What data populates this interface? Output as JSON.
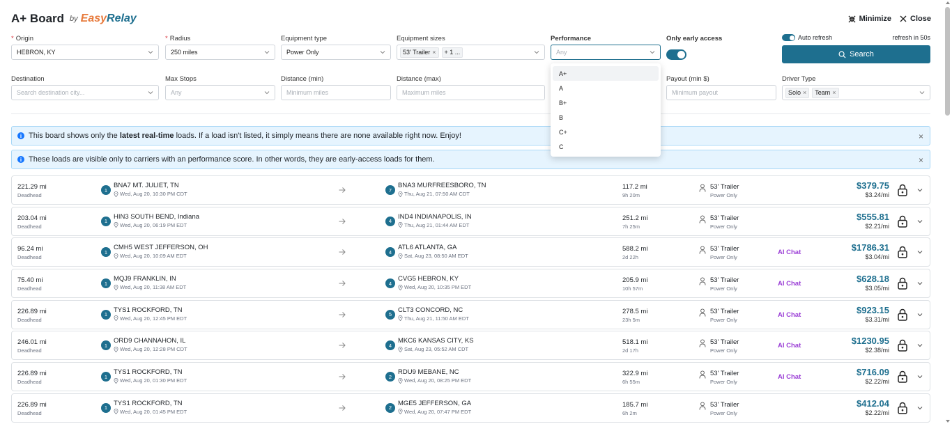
{
  "header": {
    "title": "A+ Board",
    "by": "by",
    "brand_a": "Easy",
    "brand_b": "Relay",
    "minimize": "Minimize",
    "close": "Close"
  },
  "filters": {
    "origin": {
      "label": "Origin",
      "value": "HEBRON, KY"
    },
    "radius": {
      "label": "Radius",
      "value": "250 miles"
    },
    "equipment_type": {
      "label": "Equipment type",
      "value": "Power Only"
    },
    "equipment_sizes": {
      "label": "Equipment sizes",
      "tag": "53' Trailer",
      "more": "+ 1 ..."
    },
    "performance": {
      "label": "Performance",
      "placeholder": "Any"
    },
    "early_access": {
      "label": "Only early access"
    },
    "auto_refresh": {
      "label": "Auto refresh",
      "countdown": "refresh in 50s"
    },
    "search": "Search",
    "destination": {
      "label": "Destination",
      "placeholder": "Search destination city..."
    },
    "max_stops": {
      "label": "Max Stops",
      "placeholder": "Any"
    },
    "distance_min": {
      "label": "Distance (min)",
      "placeholder": "Minimum miles"
    },
    "distance_max": {
      "label": "Distance (max)",
      "placeholder": "Maximum miles"
    },
    "payout_min": {
      "label": "Payout (min $)",
      "placeholder": "Minimum payout"
    },
    "driver_type": {
      "label": "Driver Type",
      "tags": [
        "Solo",
        "Team"
      ]
    }
  },
  "performance_options": [
    "A+",
    "A",
    "B+",
    "B",
    "C+",
    "C"
  ],
  "banners": {
    "b1_pre": "This board shows only the ",
    "b1_bold": "latest real-time",
    "b1_post": " loads. If a load isn't listed, it simply means there are none available right now. Enjoy!",
    "b2": "These loads are visible only to carriers with an performance score. In other words, they are early-access loads for them."
  },
  "row_labels": {
    "deadhead": "Deadhead",
    "ai_chat": "AI Chat"
  },
  "loads": [
    {
      "deadhead": "221.29 mi",
      "o_num": "1",
      "o_city": "BNA7 MT. JULIET, TN",
      "o_time": "Wed, Aug 20, 10:30 PM CDT",
      "d_num": "7",
      "d_city": "BNA3 MURFREESBORO, TN",
      "d_time": "Thu, Aug 21, 07:50 AM CDT",
      "dist": "117.2 mi",
      "dur": "9h 20m",
      "equip": "53' Trailer",
      "type": "Power Only",
      "ai": "",
      "price": "$379.75",
      "rate": "$3.24/mi"
    },
    {
      "deadhead": "203.04 mi",
      "o_num": "1",
      "o_city": "HIN3 SOUTH BEND, Indiana",
      "o_time": "Wed, Aug 20, 06:19 PM EDT",
      "d_num": "4",
      "d_city": "IND4 INDIANAPOLIS, IN",
      "d_time": "Thu, Aug 21, 01:44 AM EDT",
      "dist": "251.2 mi",
      "dur": "7h 25m",
      "equip": "53' Trailer",
      "type": "Power Only",
      "ai": "",
      "price": "$555.81",
      "rate": "$2.21/mi"
    },
    {
      "deadhead": "96.24 mi",
      "o_num": "1",
      "o_city": "CMH5 WEST JEFFERSON, OH",
      "o_time": "Wed, Aug 20, 10:09 AM EDT",
      "d_num": "4",
      "d_city": "ATL6 ATLANTA, GA",
      "d_time": "Sat, Aug 23, 08:50 AM EDT",
      "dist": "588.2 mi",
      "dur": "2d 22h",
      "equip": "53' Trailer",
      "type": "Power Only",
      "ai": "AI Chat",
      "price": "$1786.31",
      "rate": "$3.04/mi"
    },
    {
      "deadhead": "75.40 mi",
      "o_num": "1",
      "o_city": "MQJ9 FRANKLIN, IN",
      "o_time": "Wed, Aug 20, 11:38 AM EDT",
      "d_num": "4",
      "d_city": "CVG5 HEBRON, KY",
      "d_time": "Wed, Aug 20, 10:35 PM EDT",
      "dist": "205.9 mi",
      "dur": "10h 57m",
      "equip": "53' Trailer",
      "type": "Power Only",
      "ai": "AI Chat",
      "price": "$628.18",
      "rate": "$3.05/mi"
    },
    {
      "deadhead": "226.89 mi",
      "o_num": "1",
      "o_city": "TYS1 ROCKFORD, TN",
      "o_time": "Wed, Aug 20, 12:45 PM EDT",
      "d_num": "5",
      "d_city": "CLT3 CONCORD, NC",
      "d_time": "Thu, Aug 21, 11:50 AM EDT",
      "dist": "278.5 mi",
      "dur": "23h 5m",
      "equip": "53' Trailer",
      "type": "Power Only",
      "ai": "AI Chat",
      "price": "$923.15",
      "rate": "$3.31/mi"
    },
    {
      "deadhead": "246.01 mi",
      "o_num": "1",
      "o_city": "ORD9 CHANNAHON, IL",
      "o_time": "Wed, Aug 20, 12:28 PM CDT",
      "d_num": "4",
      "d_city": "MKC6 KANSAS CITY, KS",
      "d_time": "Sat, Aug 23, 05:52 AM CDT",
      "dist": "518.1 mi",
      "dur": "2d 17h",
      "equip": "53' Trailer",
      "type": "Power Only",
      "ai": "AI Chat",
      "price": "$1230.95",
      "rate": "$2.38/mi"
    },
    {
      "deadhead": "226.89 mi",
      "o_num": "1",
      "o_city": "TYS1 ROCKFORD, TN",
      "o_time": "Wed, Aug 20, 01:30 PM EDT",
      "d_num": "2",
      "d_city": "RDU9 MEBANE, NC",
      "d_time": "Wed, Aug 20, 08:25 PM EDT",
      "dist": "322.9 mi",
      "dur": "6h 55m",
      "equip": "53' Trailer",
      "type": "Power Only",
      "ai": "AI Chat",
      "price": "$716.09",
      "rate": "$2.22/mi"
    },
    {
      "deadhead": "226.89 mi",
      "o_num": "1",
      "o_city": "TYS1 ROCKFORD, TN",
      "o_time": "Wed, Aug 20, 01:45 PM EDT",
      "d_num": "2",
      "d_city": "MGE5 JEFFERSON, GA",
      "d_time": "Wed, Aug 20, 07:47 PM EDT",
      "dist": "185.7 mi",
      "dur": "6h 2m",
      "equip": "53' Trailer",
      "type": "Power Only",
      "ai": "",
      "price": "$412.04",
      "rate": "$2.22/mi"
    }
  ]
}
